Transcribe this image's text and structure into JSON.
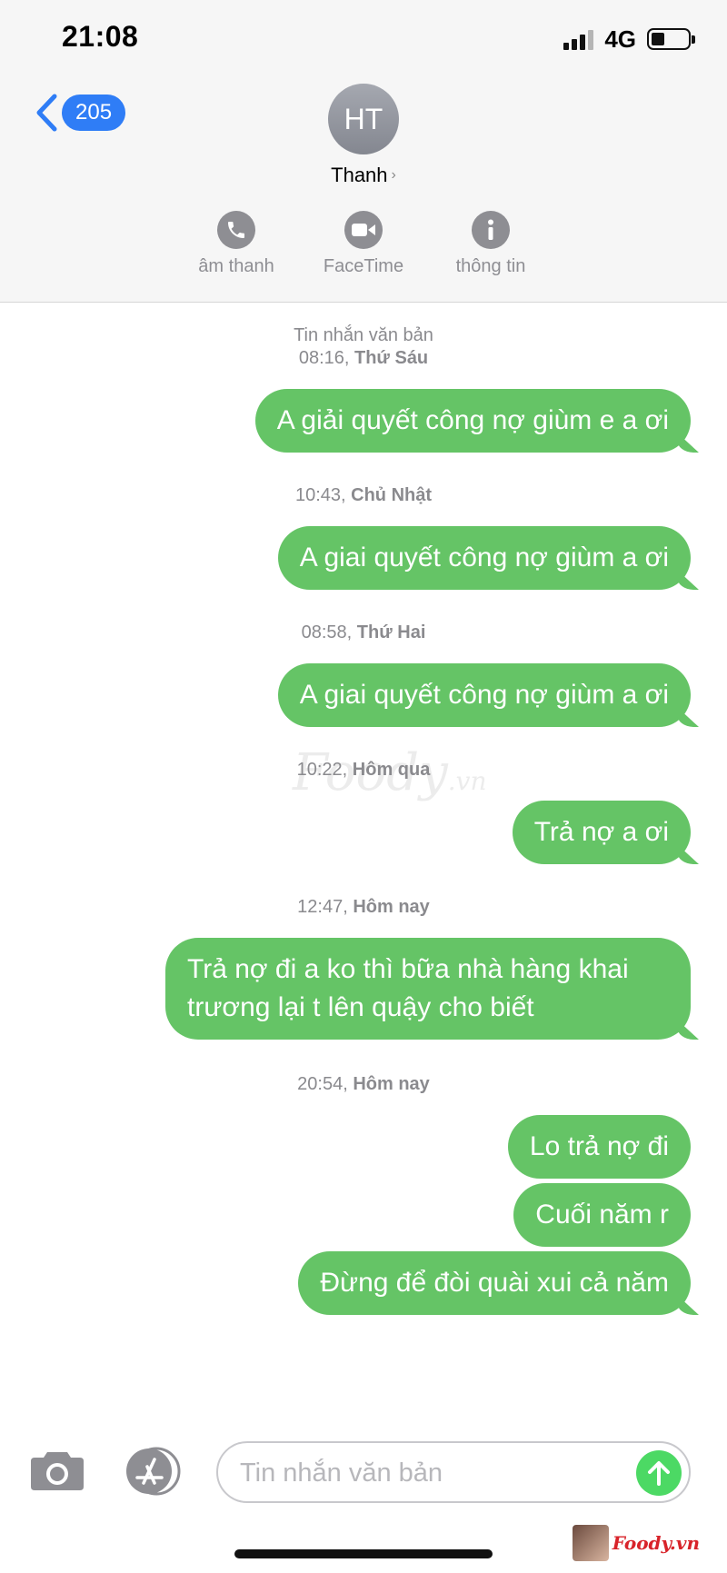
{
  "status_bar": {
    "time": "21:08",
    "network": "4G"
  },
  "nav": {
    "back_count": "205"
  },
  "contact": {
    "initials": "HT",
    "name": "Thanh"
  },
  "actions": [
    {
      "label": "âm thanh",
      "icon": "phone-icon"
    },
    {
      "label": "FaceTime",
      "icon": "video-icon"
    },
    {
      "label": "thông tin",
      "icon": "info-icon"
    }
  ],
  "conversation": {
    "header_label": "Tin nhắn văn bản",
    "timestamps": [
      {
        "time": "08:16,",
        "day": "Thứ Sáu"
      },
      {
        "time": "10:43,",
        "day": "Chủ Nhật"
      },
      {
        "time": "08:58,",
        "day": "Thứ Hai"
      },
      {
        "time": "10:22,",
        "day": "Hôm qua"
      },
      {
        "time": "12:47,",
        "day": "Hôm nay"
      },
      {
        "time": "20:54,",
        "day": "Hôm nay"
      }
    ],
    "messages": [
      "A giải quyết công nợ giùm e a ơi",
      "A giai quyết công nợ giùm a ơi",
      "A giai quyết công nợ giùm a ơi",
      "Trả nợ a ơi",
      "Trả nợ đi a ko thì bữa nhà hàng khai trương lại t lên quậy cho biết",
      "Lo trả nợ đi",
      "Cuối năm r",
      "Đừng để đòi quài xui cả năm"
    ]
  },
  "composer": {
    "placeholder": "Tin nhắn văn bản"
  },
  "watermark": {
    "text": "Foody.vn",
    "corner_brand": "Foody.vn"
  },
  "colors": {
    "bubble": "#65c466",
    "accent": "#2f7df6",
    "send": "#4cd964"
  }
}
